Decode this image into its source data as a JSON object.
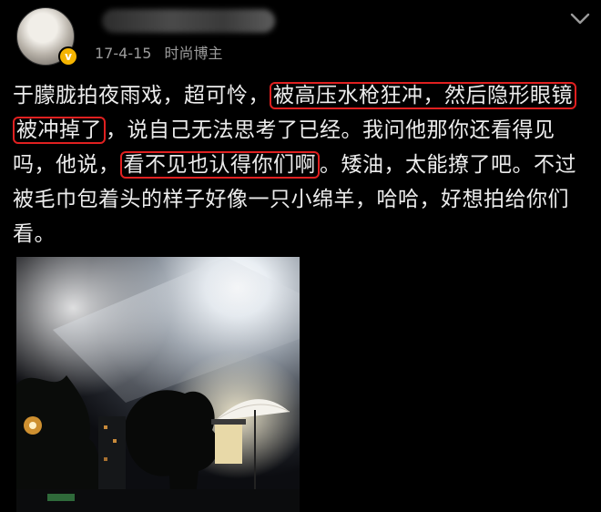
{
  "post": {
    "date": "17-4-15",
    "source": "时尚博主",
    "text_1": "于朦胧拍夜雨戏，超可怜，",
    "highlight_1": "被高压水枪狂冲，然后隐形眼镜被冲掉了",
    "text_2": "，说自己无法思考了已经。我问他那你还看得见吗，他说，",
    "highlight_2": "看不见也认得你们啊",
    "text_3": "。矮油，太能撩了吧。不过被毛巾包着头的样子好像一只小绵羊，哈哈，好想拍给你们看。"
  },
  "icons": {
    "verified": "verified-badge-icon",
    "more": "chevron-down-icon"
  },
  "colors": {
    "background": "#000000",
    "text": "#ececec",
    "meta_text": "#9c9c9c",
    "highlight_border": "#e02020",
    "badge": "#f5b400"
  }
}
